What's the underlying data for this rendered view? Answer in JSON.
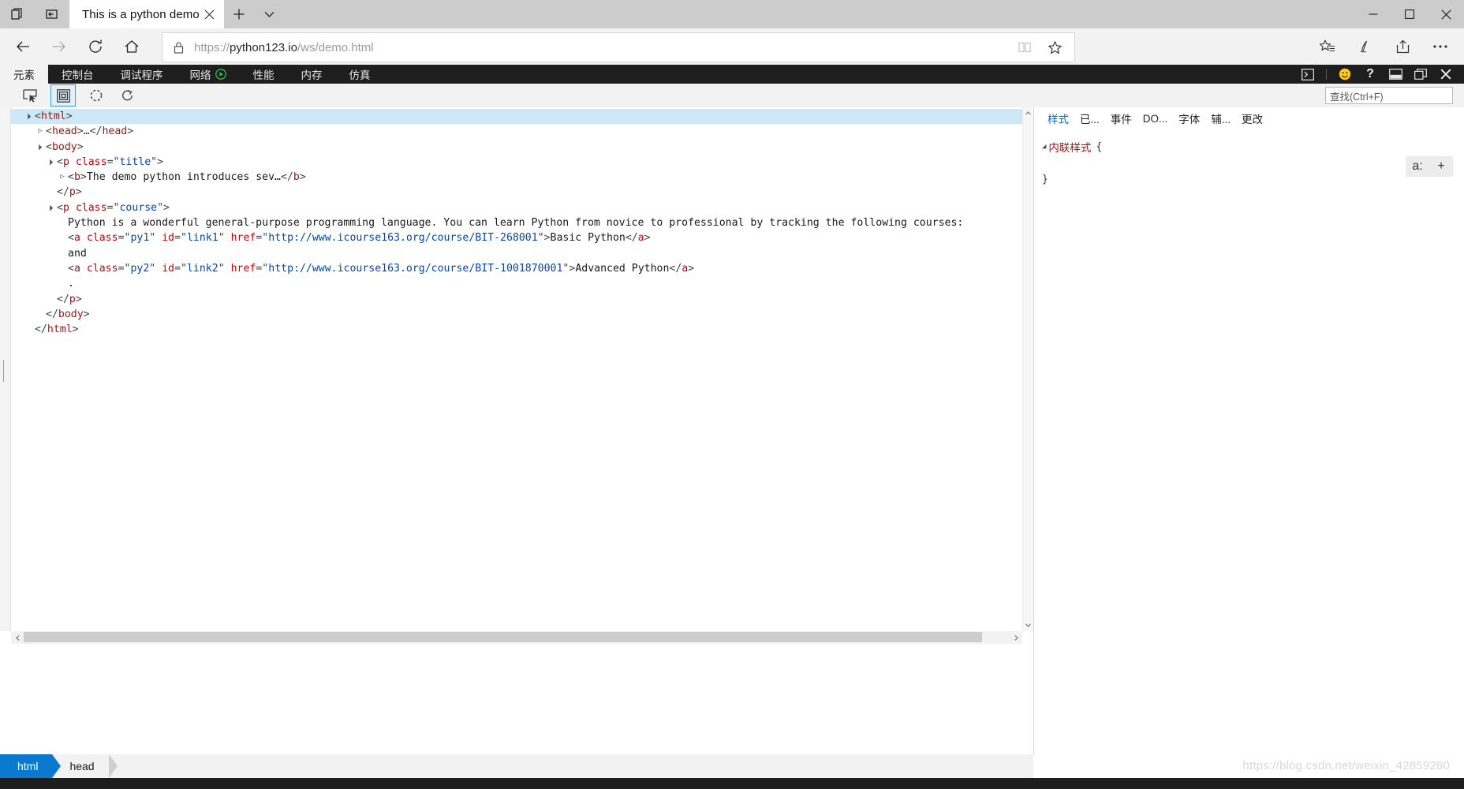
{
  "window": {
    "tab_title": "This is a python demo p",
    "tab_close_icon": "close-icon",
    "new_tab_icon": "plus-icon",
    "tab_menu_icon": "chevron-down-icon",
    "minimize_icon": "minimize-icon",
    "maximize_icon": "maximize-icon",
    "close_icon": "close-icon",
    "show_tabs_icon": "show-tabs-icon",
    "set_tabs_aside_icon": "set-tabs-aside-icon"
  },
  "nav": {
    "back_icon": "back-arrow-icon",
    "forward_icon": "forward-arrow-icon",
    "refresh_icon": "refresh-icon",
    "home_icon": "home-icon",
    "lock_icon": "lock-icon",
    "url_scheme": "https://",
    "url_host": "python123.io",
    "url_path": "/ws/demo.html",
    "url_full": "https://python123.io/ws/demo.html",
    "reading_view_icon": "book-icon",
    "favorite_icon": "star-icon",
    "hub_icon": "favorites-hub-icon",
    "notes_icon": "pen-icon",
    "share_icon": "share-icon",
    "more_icon": "ellipsis-icon"
  },
  "devtools": {
    "tabs": [
      {
        "label": "元素",
        "active": true,
        "icon": null
      },
      {
        "label": "控制台",
        "active": false,
        "icon": null
      },
      {
        "label": "调试程序",
        "active": false,
        "icon": null
      },
      {
        "label": "网络",
        "active": false,
        "icon": "record-play-icon"
      },
      {
        "label": "性能",
        "active": false,
        "icon": null
      },
      {
        "label": "内存",
        "active": false,
        "icon": null
      },
      {
        "label": "仿真",
        "active": false,
        "icon": null
      }
    ],
    "right_icons": [
      "console-drawer-icon",
      "feedback-smiley-icon",
      "help-icon",
      "dock-to-bottom-icon",
      "undock-window-icon",
      "close-devtools-icon"
    ],
    "subtoolbar": {
      "inspect_icon": "inspect-element-icon",
      "select_icon": "select-element-icon",
      "refresh_icon": "refresh-dom-icon",
      "break_icon": "break-on-icon"
    },
    "find_placeholder": "查找(Ctrl+F)"
  },
  "dom": [
    {
      "indent": 0,
      "twisty": "open",
      "selected": true,
      "parts": [
        {
          "t": "punct",
          "v": "<"
        },
        {
          "t": "tag",
          "v": "html"
        },
        {
          "t": "punct",
          "v": ">"
        }
      ]
    },
    {
      "indent": 1,
      "twisty": "closed",
      "selected": false,
      "parts": [
        {
          "t": "punct",
          "v": "<"
        },
        {
          "t": "tag",
          "v": "head"
        },
        {
          "t": "punct",
          "v": ">…</"
        },
        {
          "t": "tag",
          "v": "head"
        },
        {
          "t": "punct",
          "v": ">"
        }
      ]
    },
    {
      "indent": 1,
      "twisty": "open",
      "selected": false,
      "parts": [
        {
          "t": "punct",
          "v": "<"
        },
        {
          "t": "tag",
          "v": "body"
        },
        {
          "t": "punct",
          "v": ">"
        }
      ]
    },
    {
      "indent": 2,
      "twisty": "open",
      "selected": false,
      "parts": [
        {
          "t": "punct",
          "v": "<"
        },
        {
          "t": "tag",
          "v": "p"
        },
        {
          "t": "txt",
          "v": " "
        },
        {
          "t": "attr",
          "v": "class"
        },
        {
          "t": "punct",
          "v": "="
        },
        {
          "t": "punct",
          "v": "\""
        },
        {
          "t": "val",
          "v": "title"
        },
        {
          "t": "punct",
          "v": "\">"
        }
      ]
    },
    {
      "indent": 3,
      "twisty": "closed",
      "selected": false,
      "parts": [
        {
          "t": "punct",
          "v": "<"
        },
        {
          "t": "tag",
          "v": "b"
        },
        {
          "t": "punct",
          "v": ">"
        },
        {
          "t": "txt",
          "v": "The demo python introduces sev…"
        },
        {
          "t": "punct",
          "v": "</"
        },
        {
          "t": "tag",
          "v": "b"
        },
        {
          "t": "punct",
          "v": ">"
        }
      ]
    },
    {
      "indent": 2,
      "twisty": "none",
      "selected": false,
      "parts": [
        {
          "t": "punct",
          "v": "</"
        },
        {
          "t": "tag",
          "v": "p"
        },
        {
          "t": "punct",
          "v": ">"
        }
      ]
    },
    {
      "indent": 2,
      "twisty": "open",
      "selected": false,
      "parts": [
        {
          "t": "punct",
          "v": "<"
        },
        {
          "t": "tag",
          "v": "p"
        },
        {
          "t": "txt",
          "v": " "
        },
        {
          "t": "attr",
          "v": "class"
        },
        {
          "t": "punct",
          "v": "="
        },
        {
          "t": "punct",
          "v": "\""
        },
        {
          "t": "val",
          "v": "course"
        },
        {
          "t": "punct",
          "v": "\">"
        }
      ]
    },
    {
      "indent": 3,
      "twisty": "none",
      "selected": false,
      "parts": [
        {
          "t": "txt",
          "v": "Python is a wonderful general-purpose programming language. You can learn Python from novice to professional by tracking the following courses:"
        }
      ]
    },
    {
      "indent": 3,
      "twisty": "none",
      "selected": false,
      "parts": [
        {
          "t": "punct",
          "v": "<"
        },
        {
          "t": "tag",
          "v": "a"
        },
        {
          "t": "txt",
          "v": " "
        },
        {
          "t": "attr",
          "v": "class"
        },
        {
          "t": "punct",
          "v": "="
        },
        {
          "t": "punct",
          "v": "\""
        },
        {
          "t": "val",
          "v": "py1"
        },
        {
          "t": "punct",
          "v": "\" "
        },
        {
          "t": "attr",
          "v": "id"
        },
        {
          "t": "punct",
          "v": "="
        },
        {
          "t": "punct",
          "v": "\""
        },
        {
          "t": "val",
          "v": "link1"
        },
        {
          "t": "punct",
          "v": "\" "
        },
        {
          "t": "attr",
          "v": "href"
        },
        {
          "t": "punct",
          "v": "="
        },
        {
          "t": "punct",
          "v": "\""
        },
        {
          "t": "val",
          "v": "http://www.icourse163.org/course/BIT-268001"
        },
        {
          "t": "punct",
          "v": "\">"
        },
        {
          "t": "txt",
          "v": "Basic Python"
        },
        {
          "t": "punct",
          "v": "</"
        },
        {
          "t": "tag",
          "v": "a"
        },
        {
          "t": "punct",
          "v": ">"
        }
      ]
    },
    {
      "indent": 3,
      "twisty": "none",
      "selected": false,
      "parts": [
        {
          "t": "txt",
          "v": "and"
        }
      ]
    },
    {
      "indent": 3,
      "twisty": "none",
      "selected": false,
      "parts": [
        {
          "t": "punct",
          "v": "<"
        },
        {
          "t": "tag",
          "v": "a"
        },
        {
          "t": "txt",
          "v": " "
        },
        {
          "t": "attr",
          "v": "class"
        },
        {
          "t": "punct",
          "v": "="
        },
        {
          "t": "punct",
          "v": "\""
        },
        {
          "t": "val",
          "v": "py2"
        },
        {
          "t": "punct",
          "v": "\" "
        },
        {
          "t": "attr",
          "v": "id"
        },
        {
          "t": "punct",
          "v": "="
        },
        {
          "t": "punct",
          "v": "\""
        },
        {
          "t": "val",
          "v": "link2"
        },
        {
          "t": "punct",
          "v": "\" "
        },
        {
          "t": "attr",
          "v": "href"
        },
        {
          "t": "punct",
          "v": "="
        },
        {
          "t": "punct",
          "v": "\""
        },
        {
          "t": "val",
          "v": "http://www.icourse163.org/course/BIT-1001870001"
        },
        {
          "t": "punct",
          "v": "\">"
        },
        {
          "t": "txt",
          "v": "Advanced Python"
        },
        {
          "t": "punct",
          "v": "</"
        },
        {
          "t": "tag",
          "v": "a"
        },
        {
          "t": "punct",
          "v": ">"
        }
      ]
    },
    {
      "indent": 3,
      "twisty": "none",
      "selected": false,
      "parts": [
        {
          "t": "txt",
          "v": "."
        }
      ]
    },
    {
      "indent": 2,
      "twisty": "none",
      "selected": false,
      "parts": [
        {
          "t": "punct",
          "v": "</"
        },
        {
          "t": "tag",
          "v": "p"
        },
        {
          "t": "punct",
          "v": ">"
        }
      ]
    },
    {
      "indent": 1,
      "twisty": "none",
      "selected": false,
      "parts": [
        {
          "t": "punct",
          "v": "</"
        },
        {
          "t": "tag",
          "v": "body"
        },
        {
          "t": "punct",
          "v": ">"
        }
      ]
    },
    {
      "indent": 0,
      "twisty": "none",
      "selected": false,
      "parts": [
        {
          "t": "punct",
          "v": "</"
        },
        {
          "t": "tag",
          "v": "html"
        },
        {
          "t": "punct",
          "v": ">"
        }
      ]
    }
  ],
  "styles_pane": {
    "tabs": [
      {
        "label": "样式",
        "active": true
      },
      {
        "label": "已...",
        "active": false
      },
      {
        "label": "事件",
        "active": false
      },
      {
        "label": "DO...",
        "active": false
      },
      {
        "label": "字体",
        "active": false
      },
      {
        "label": "辅...",
        "active": false
      },
      {
        "label": "更改",
        "active": false
      }
    ],
    "rule_selector": "内联样式",
    "rule_open_brace": "{",
    "rule_close_brace": "}",
    "action_pseudo": "a:",
    "action_add": "+",
    "pseudo_icon": "pseudo-state-icon",
    "add_icon": "add-rule-icon"
  },
  "breadcrumbs": [
    {
      "label": "html",
      "active": true
    },
    {
      "label": "head",
      "active": false
    }
  ],
  "watermark": "https://blog.csdn.net/weixin_42859280",
  "colors": {
    "accent_blue": "#0a7ad0",
    "devtools_dark": "#1e1e1e",
    "selection_blue": "#cfe8f7",
    "tag_red": "#a31515",
    "attr_red": "#cc0000",
    "value_blue": "#0645ad",
    "link_blue": "#0a6cbd"
  }
}
